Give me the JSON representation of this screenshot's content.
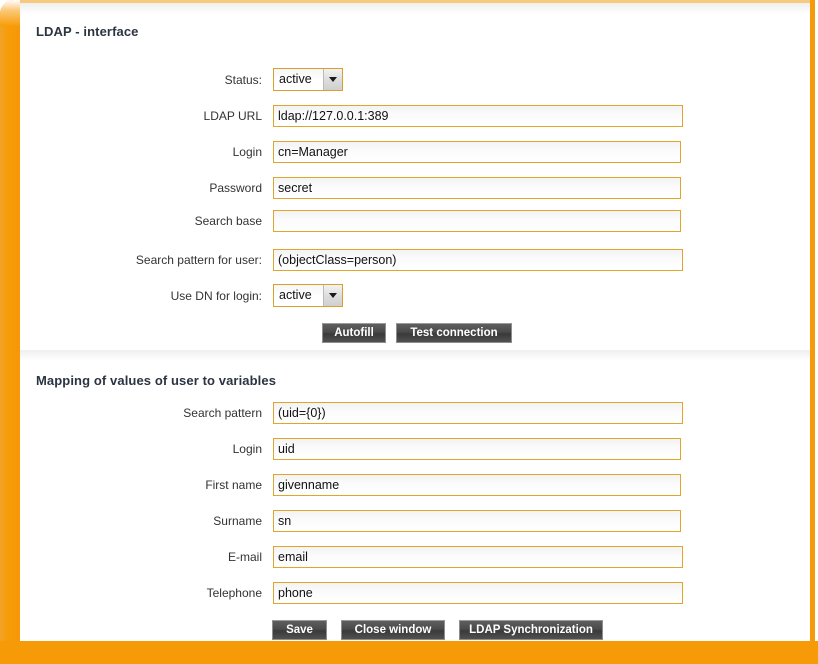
{
  "frame": {
    "accent_color": "#f79a08",
    "field_border_color": "#e0a52c",
    "title_color": "#2b3441",
    "button_color": "#4a4a4a"
  },
  "sections": [
    {
      "title": "LDAP - interface",
      "fields": [
        {
          "label": "Status:",
          "type": "select",
          "value": "active"
        },
        {
          "label": "LDAP URL",
          "type": "text",
          "value": "ldap://127.0.0.1:389"
        },
        {
          "label": "Login",
          "type": "text",
          "value": "cn=Manager"
        },
        {
          "label": "Password",
          "type": "text",
          "value": "secret"
        },
        {
          "label": "Search base",
          "type": "text",
          "value": ""
        },
        {
          "label": "Search pattern for user:",
          "type": "text",
          "value": "(objectClass=person)"
        },
        {
          "label": "Use DN for login:",
          "type": "select",
          "value": "active"
        }
      ],
      "buttons": [
        {
          "label": "Autofill"
        },
        {
          "label": "Test connection"
        }
      ]
    },
    {
      "title": "Mapping of values of user to variables",
      "fields": [
        {
          "label": "Search pattern",
          "type": "text",
          "value": "(uid={0})"
        },
        {
          "label": "Login",
          "type": "text",
          "value": "uid"
        },
        {
          "label": "First name",
          "type": "text",
          "value": "givenname"
        },
        {
          "label": "Surname",
          "type": "text",
          "value": "sn"
        },
        {
          "label": "E-mail",
          "type": "text",
          "value": "email"
        },
        {
          "label": "Telephone",
          "type": "text",
          "value": "phone"
        }
      ],
      "buttons": [
        {
          "label": "Save"
        },
        {
          "label": "Close window"
        },
        {
          "label": "LDAP Synchronization"
        }
      ]
    }
  ]
}
